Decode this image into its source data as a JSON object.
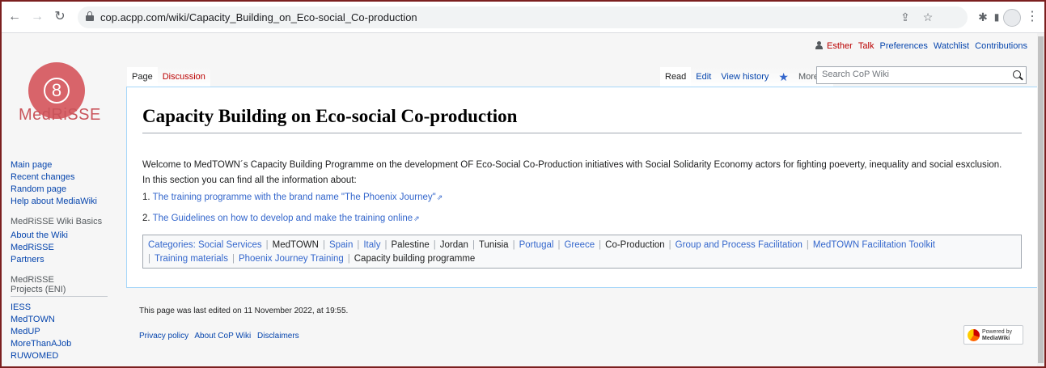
{
  "browser": {
    "url": "cop.acpp.com/wiki/Capacity_Building_on_Eco-social_Co-production"
  },
  "personal": {
    "user": "Esther",
    "links": [
      "Talk",
      "Preferences",
      "Watchlist",
      "Contributions"
    ]
  },
  "brand": {
    "name": "MedRiSSE"
  },
  "sidebar": {
    "nav": [
      "Main page",
      "Recent changes",
      "Random page",
      "Help about MediaWiki"
    ],
    "section1_heading": "MedRiSSE Wiki Basics",
    "section1": [
      "About the Wiki",
      "MedRiSSE",
      "Partners"
    ],
    "section2_heading": "MedRiSSE Projects (ENI)",
    "section2": [
      "IESS",
      "MedTOWN",
      "MedUP",
      "MoreThanAJob",
      "RUWOMED"
    ]
  },
  "tabs": {
    "page": "Page",
    "discussion": "Discussion",
    "read": "Read",
    "edit": "Edit",
    "history": "View history",
    "more": "More"
  },
  "search": {
    "placeholder": "Search CoP Wiki"
  },
  "article": {
    "title": "Capacity Building on Eco-social Co-production",
    "intro_line1": "Welcome to MedTOWN´s Capacity Building Programme on the development OF Eco-Social Co-Production initiatives with Social Solidarity Economy actors for fighting poeverty, inequality and social esxclusion.",
    "intro_line2": "In this section you can find all the information about:",
    "item1_num": "1.",
    "item1": "The training programme with the brand name \"The Phoenix Journey\"",
    "item2_num": "2.",
    "item2": "The Guidelines on how to develop and make the training online"
  },
  "categories": {
    "label": "Categories:",
    "items": [
      "Social Services",
      "MedTOWN",
      "Spain",
      "Italy",
      "Palestine",
      "Jordan",
      "Tunisia",
      "Portugal",
      "Greece",
      "Co-Production",
      "Group and Process Facilitation",
      "MedTOWN Facilitation Toolkit",
      "Training materials",
      "Phoenix Journey Training",
      "Capacity building programme"
    ]
  },
  "footer": {
    "last_edited": "This page was last edited on 11 November 2022, at 19:55.",
    "links": [
      "Privacy policy",
      "About CoP Wiki",
      "Disclaimers"
    ],
    "powered_line1": "Powered by",
    "powered_line2": "MediaWiki"
  }
}
